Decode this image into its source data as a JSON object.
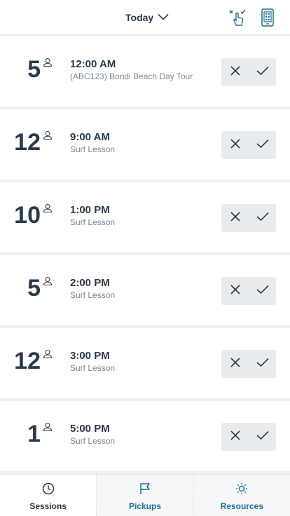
{
  "header": {
    "date_label": "Today",
    "icons": [
      "chevron-down-icon",
      "bulk-checkin-icon",
      "scanner-icon"
    ]
  },
  "sessions": [
    {
      "count": "5",
      "time": "12:00 AM",
      "desc": "(ABC123) Bondi Beach Day Tour"
    },
    {
      "count": "12",
      "time": "9:00 AM",
      "desc": "Surf Lesson"
    },
    {
      "count": "10",
      "time": "1:00 PM",
      "desc": "Surf Lesson"
    },
    {
      "count": "5",
      "time": "2:00 PM",
      "desc": "Surf Lesson"
    },
    {
      "count": "12",
      "time": "3:00 PM",
      "desc": "Surf Lesson"
    },
    {
      "count": "1",
      "time": "5:00 PM",
      "desc": "Surf Lesson"
    }
  ],
  "nav": {
    "sessions": "Sessions",
    "pickups": "Pickups",
    "resources": "Resources"
  },
  "colors": {
    "text": "#2b3a4a",
    "muted": "#7a8693",
    "accent": "#1d6f8f",
    "background": "#eef0f2"
  }
}
